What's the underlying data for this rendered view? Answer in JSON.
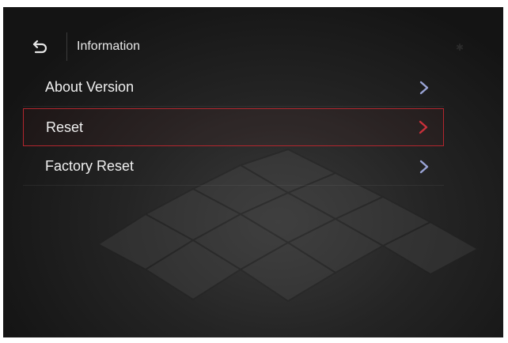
{
  "header": {
    "title": "Information",
    "back_icon": "back-arrow-icon"
  },
  "menu": {
    "items": [
      {
        "label": "About Version",
        "selected": false
      },
      {
        "label": "Reset",
        "selected": true
      },
      {
        "label": "Factory Reset",
        "selected": false
      }
    ]
  },
  "colors": {
    "selection_border": "#b3262e",
    "chevron_default": "#9aa4d6",
    "chevron_selected": "#c8303a",
    "text": "#f0f0f0"
  }
}
